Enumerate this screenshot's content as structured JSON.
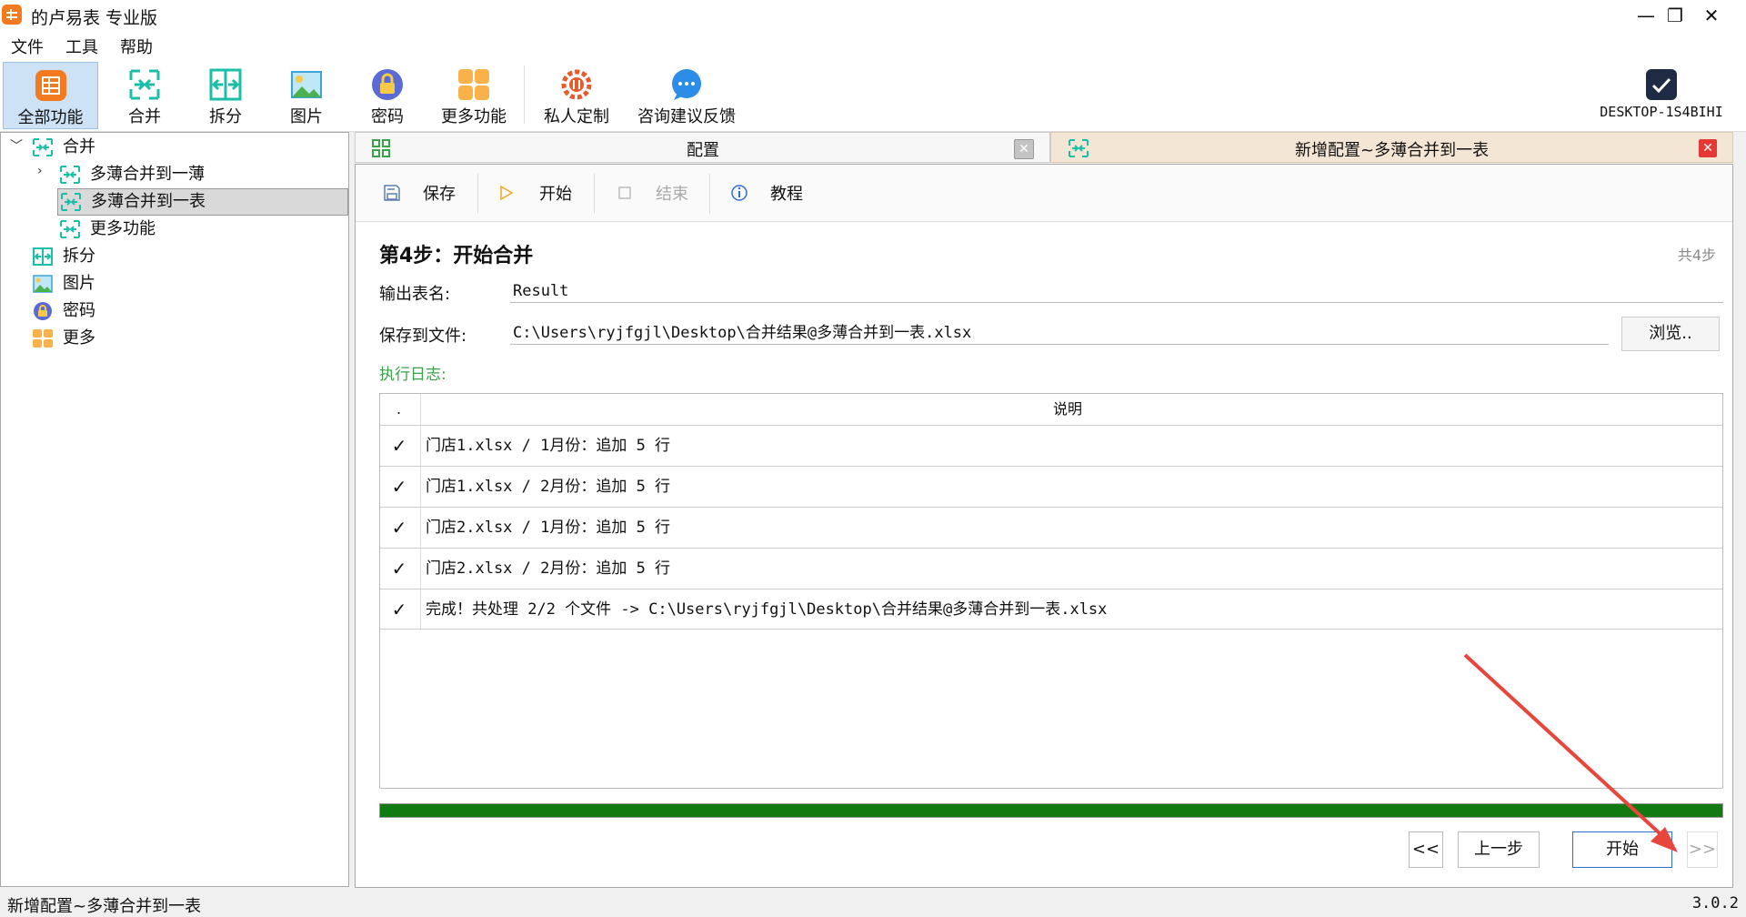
{
  "window": {
    "title": "的卢易表 专业版",
    "minimize": "—",
    "maximize": "❐",
    "close": "✕"
  },
  "menu": [
    "文件",
    "工具",
    "帮助"
  ],
  "toolbar": {
    "items": [
      {
        "label": "全部功能",
        "icon": "grid-app-icon"
      },
      {
        "label": "合并",
        "icon": "merge-icon"
      },
      {
        "label": "拆分",
        "icon": "split-icon"
      },
      {
        "label": "图片",
        "icon": "image-icon"
      },
      {
        "label": "密码",
        "icon": "lock-icon"
      },
      {
        "label": "更多功能",
        "icon": "more-grid-icon"
      },
      {
        "label": "私人定制",
        "icon": "custom-gear-icon"
      },
      {
        "label": "咨询建议反馈",
        "icon": "chat-bubble-icon"
      }
    ],
    "computer_name": "DESKTOP-1S4BIHI"
  },
  "tree": {
    "merge": "合并",
    "merge_books": "多薄合并到一薄",
    "merge_one_sheet": "多薄合并到一表",
    "merge_more": "更多功能",
    "split": "拆分",
    "image": "图片",
    "password": "密码",
    "more": "更多"
  },
  "tabs": {
    "config": "配置",
    "new_config": "新增配置~多薄合并到一表"
  },
  "subtoolbar": {
    "save": "保存",
    "start": "开始",
    "stop": "结束",
    "tutorial": "教程"
  },
  "step": {
    "title": "第4步：开始合并",
    "total": "共4步"
  },
  "form": {
    "output_sheet_label": "输出表名:",
    "output_sheet_value": "Result",
    "save_file_label": "保存到文件:",
    "save_file_value": "C:\\Users\\ryjfgjl\\Desktop\\合并结果@多薄合并到一表.xlsx",
    "browse": "浏览.."
  },
  "log": {
    "label": "执行日志:",
    "col_status": ".",
    "col_desc": "说明",
    "rows": [
      {
        "status": "✓",
        "msg": "门店1.xlsx / 1月份：追加 5 行"
      },
      {
        "status": "✓",
        "msg": "门店1.xlsx / 2月份：追加 5 行"
      },
      {
        "status": "✓",
        "msg": "门店2.xlsx / 1月份：追加 5 行"
      },
      {
        "status": "✓",
        "msg": "门店2.xlsx / 2月份：追加 5 行"
      },
      {
        "status": "✓",
        "msg": "完成！共处理 2/2 个文件 -> C:\\Users\\ryjfgjl\\Desktop\\合并结果@多薄合并到一表.xlsx"
      }
    ]
  },
  "progress": {
    "fraction": 1.0,
    "color": "#117a11"
  },
  "nav": {
    "first": "<<",
    "prev": "上一步",
    "start": "开始",
    "next": ">>"
  },
  "status": {
    "left": "新增配置~多薄合并到一表",
    "version": "3.0.2"
  },
  "colors": {
    "accent_orange": "#f47a20",
    "merge_teal": "#1bbfa8",
    "log_label_green": "#3aa34a",
    "close_red": "#e53935"
  }
}
